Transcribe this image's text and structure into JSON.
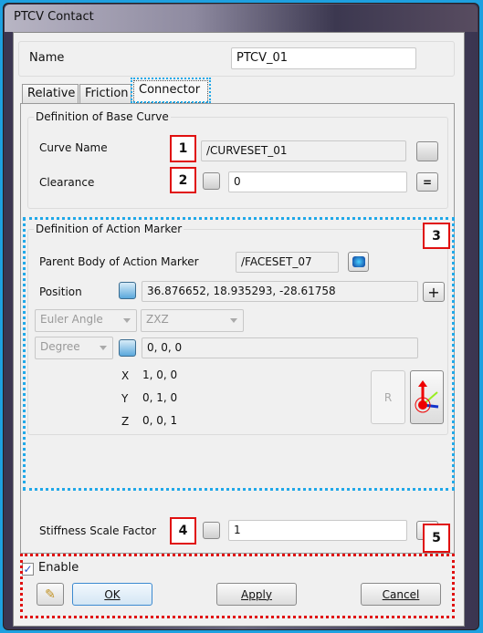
{
  "window": {
    "title": "PTCV Contact"
  },
  "name": {
    "label": "Name",
    "value": "PTCV_01"
  },
  "tabs": [
    {
      "label": "Relative"
    },
    {
      "label": "Friction"
    },
    {
      "label": "Connector",
      "active": true
    }
  ],
  "base_curve": {
    "title": "Definition of Base Curve",
    "curve_name_label": "Curve Name",
    "curve_name_value": "/CURVESET_01",
    "clearance_label": "Clearance",
    "clearance_value": "0"
  },
  "action_marker": {
    "title": "Definition of Action Marker",
    "parent_label": "Parent Body of Action Marker",
    "parent_value": "/FACESET_07",
    "position_label": "Position",
    "position_value": "36.876652, 18.935293, -28.61758",
    "orientation_type": "Euler Angle",
    "sequence": "ZXZ",
    "unit": "Degree",
    "angles": "0, 0, 0",
    "axes": [
      {
        "axis": "X",
        "value": "1, 0, 0"
      },
      {
        "axis": "Y",
        "value": "0, 1, 0"
      },
      {
        "axis": "Z",
        "value": "0, 0, 1"
      }
    ],
    "r_button": "R"
  },
  "stiffness": {
    "label": "Stiffness Scale Factor",
    "value": "1"
  },
  "badges": [
    "1",
    "2",
    "3",
    "4",
    "5"
  ],
  "footer": {
    "enable_label": "Enable",
    "enable_checked": true,
    "ok": "OK",
    "apply": "Apply",
    "cancel": "Cancel"
  },
  "colors": {
    "annotation_red": "#e01010",
    "annotation_cyan": "#20a8e8"
  }
}
